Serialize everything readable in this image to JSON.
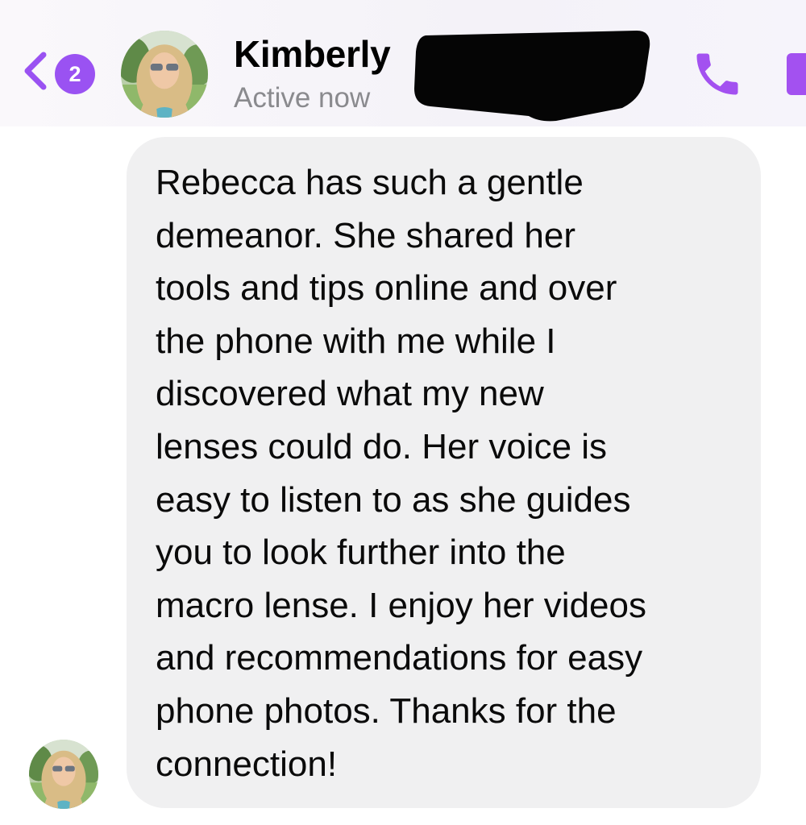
{
  "header": {
    "back_badge_count": "2",
    "contact_name": "Kimberly",
    "status": "Active now",
    "icons": {
      "back": "chevron-left-icon",
      "call": "phone-icon",
      "video": "video-camera-icon"
    },
    "accent_color": "#9a52f2"
  },
  "message": {
    "lines": [
      "Rebecca has such a gentle",
      "demeanor. She shared her",
      "tools and tips online and over",
      "the phone with me while I",
      "discovered what my new",
      "lenses could do. Her voice is",
      "easy to listen to as she guides",
      "you to look further into the",
      "macro lense. I enjoy her videos",
      "and recommendations for easy",
      "phone photos. Thanks for the",
      "connection!"
    ],
    "bubble_color": "#f0f0f1"
  }
}
